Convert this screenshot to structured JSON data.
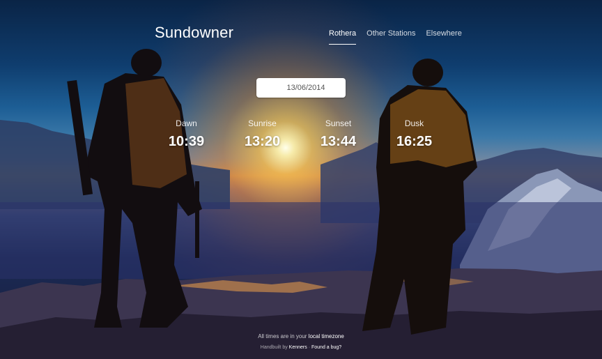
{
  "brand": "Sundowner",
  "nav": [
    {
      "label": "Rothera",
      "active": true
    },
    {
      "label": "Other Stations",
      "active": false
    },
    {
      "label": "Elsewhere",
      "active": false
    }
  ],
  "date": {
    "value": "13/06/2014",
    "icon": "calendar-icon"
  },
  "times": [
    {
      "label": "Dawn",
      "value": "10:39"
    },
    {
      "label": "Sunrise",
      "value": "13:20"
    },
    {
      "label": "Sunset",
      "value": "13:44"
    },
    {
      "label": "Dusk",
      "value": "16:25"
    }
  ],
  "footer": {
    "line1_prefix": "All times are in your",
    "line1_link": "local timezone",
    "line2_prefix": "Handbuilt by",
    "line2_author": "Kenners",
    "line2_sep": "·",
    "line2_bug": "Found a bug?"
  },
  "colors": {
    "sky_top": "#0a2446",
    "sun": "#ffbe46",
    "ground": "#121a3a"
  }
}
